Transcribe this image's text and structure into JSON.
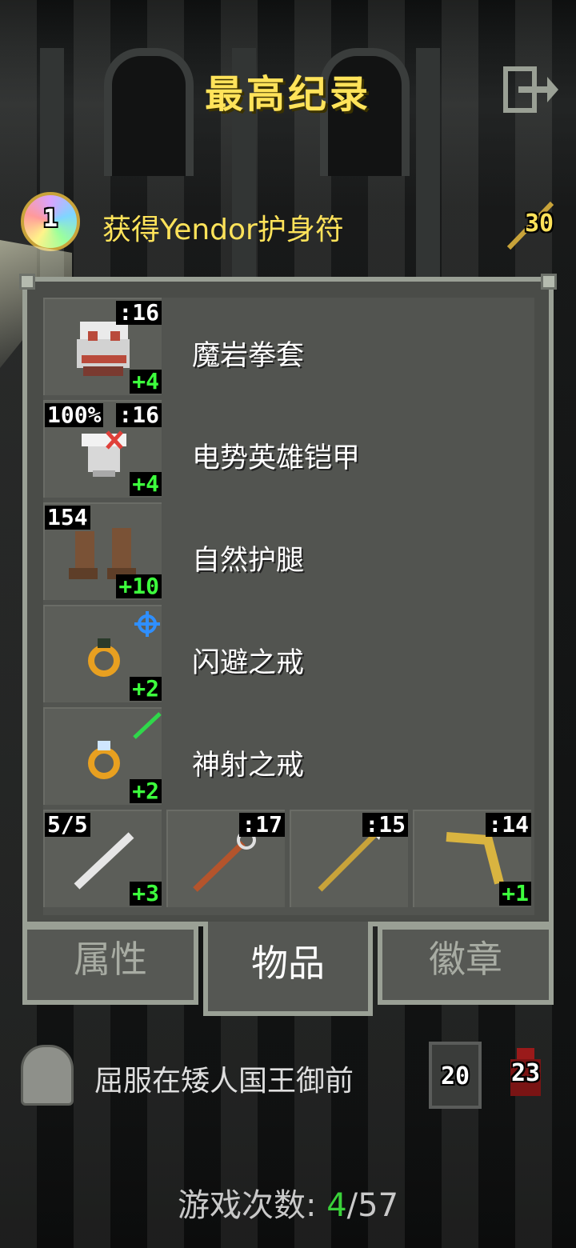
{
  "header": {
    "title": "最高纪录",
    "exit_icon": "exit-icon"
  },
  "record": {
    "rank": "1",
    "label": "获得Yendor护身符",
    "depth": "30",
    "medal_icon": "amulet-medal-icon",
    "depth_icon": "wand-icon"
  },
  "items": {
    "armor": [
      {
        "name": "魔岩拳套",
        "level_text": ":16",
        "upgrade": "+4",
        "icon": "gauntlet-icon"
      },
      {
        "name": "电势英雄铠甲",
        "level_text": ":16",
        "charge": "100%",
        "upgrade": "+4",
        "icon": "armor-icon"
      },
      {
        "name": "自然护腿",
        "level_text": "154",
        "upgrade": "+10",
        "icon": "boots-icon"
      },
      {
        "name": "闪避之戒",
        "upgrade": "+2",
        "icon": "ring-evasion-icon"
      },
      {
        "name": "神射之戒",
        "upgrade": "+2",
        "icon": "ring-sharpshooting-icon"
      }
    ],
    "quickslots": [
      {
        "level_text": "5/5",
        "upgrade": "+3",
        "icon": "wand-silver-icon"
      },
      {
        "level_text": ":17",
        "icon": "trident-icon"
      },
      {
        "level_text": ":15",
        "icon": "spear-icon"
      },
      {
        "level_text": ":14",
        "upgrade": "+1",
        "icon": "boomerang-icon"
      }
    ]
  },
  "tabs": [
    {
      "label": "属性",
      "active": false
    },
    {
      "label": "物品",
      "active": true
    },
    {
      "label": "徽章",
      "active": false
    }
  ],
  "death": {
    "cause": "屈服在矮人国王御前",
    "depth": "20",
    "level": "23",
    "tomb_icon": "tombstone-icon"
  },
  "footer": {
    "label": "游戏次数:",
    "current": "4",
    "total": "/57"
  },
  "colors": {
    "title": "#ffe35a",
    "upgrade": "#3dff3d",
    "panel": "#4a4c48",
    "border": "#9aa095"
  }
}
